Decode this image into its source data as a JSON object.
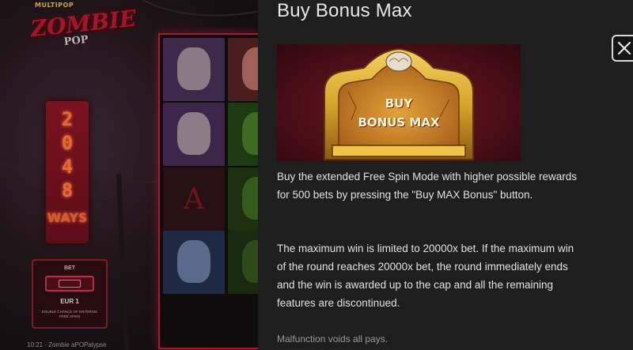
{
  "game": {
    "logo_top": "MULTIPOP",
    "logo_main": "ZOMBIE",
    "logo_sub": "POP",
    "ways_digits": [
      "2",
      "0",
      "4",
      "8"
    ],
    "ways_label": "WAYS",
    "bet": {
      "label": "BET",
      "value": "EUR 1",
      "note": "DOUBLE CHANCE OF ENTERING FREE SPINS"
    },
    "status_bar": "10:21 · Zombie aPOPalypse"
  },
  "panel": {
    "title": "Buy Bonus Max",
    "close_icon": "close-icon",
    "bonus_image_text_line1": "BUY",
    "bonus_image_text_line2": "BONUS MAX",
    "description_1": "Buy the extended Free Spin Mode with higher possible rewards for 500 bets by pressing the \"Buy MAX Bonus\" button.",
    "description_2": "The maximum win is limited to 20000x bet. If the maximum win of the round reaches 20000x bet, the round immediately ends and the win is awarded up to the cap and all the remaining features are discontinued.",
    "footnote": "Malfunction voids all pays."
  },
  "colors": {
    "panel_bg": "#1e1e1e",
    "text": "#e2e2e2",
    "accent_red": "#a11a32",
    "gold": "#d6a62a"
  }
}
